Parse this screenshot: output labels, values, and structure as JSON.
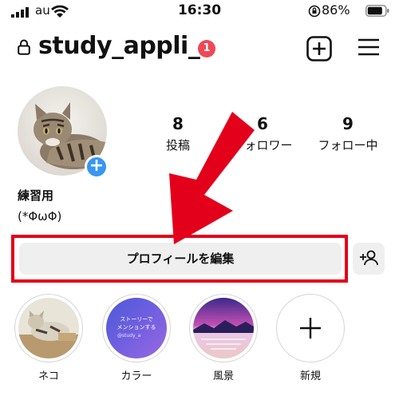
{
  "status_bar": {
    "carrier": "au",
    "time": "16:30",
    "battery": "86%"
  },
  "header": {
    "username": "study_appli_",
    "notification_count": "1"
  },
  "stats": [
    {
      "value": "8",
      "label": "投稿"
    },
    {
      "value": "6",
      "label": "フォロワー"
    },
    {
      "value": "9",
      "label": "フォロー中"
    }
  ],
  "profile": {
    "name": "練習用",
    "bio": "(*ΦωΦ)"
  },
  "actions": {
    "edit_profile": "プロフィールを編集"
  },
  "highlights": [
    {
      "label": "ネコ"
    },
    {
      "label": "カラー",
      "caption1": "ストーリーで",
      "caption2": "メンションする",
      "caption3": "@study_a"
    },
    {
      "label": "風景"
    },
    {
      "label": "新規"
    }
  ],
  "colors": {
    "accent_red": "#e3001b",
    "badge": "#ed4956",
    "add_blue": "#3897f0",
    "button_bg": "#efefef"
  }
}
